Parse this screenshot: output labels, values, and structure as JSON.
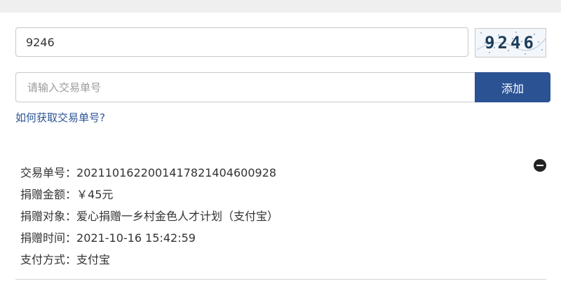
{
  "captcha": {
    "input_value": "9246",
    "image_text": "9246"
  },
  "order": {
    "placeholder": "请输入交易单号",
    "add_label": "添加",
    "help_link": "如何获取交易单号?"
  },
  "record": {
    "transaction_no_label": "交易单号：",
    "transaction_no_value": "2021101622001417821404600928",
    "amount_label": "捐赠金额：",
    "amount_value": "￥45元",
    "target_label": "捐赠对象：",
    "target_value": "爱心捐赠一乡村金色人才计划（支付宝）",
    "time_label": "捐赠时间：",
    "time_value": "2021-10-16 15:42:59",
    "method_label": "支付方式：",
    "method_value": "支付宝"
  },
  "icons": {
    "remove": "minus-circle-icon"
  }
}
